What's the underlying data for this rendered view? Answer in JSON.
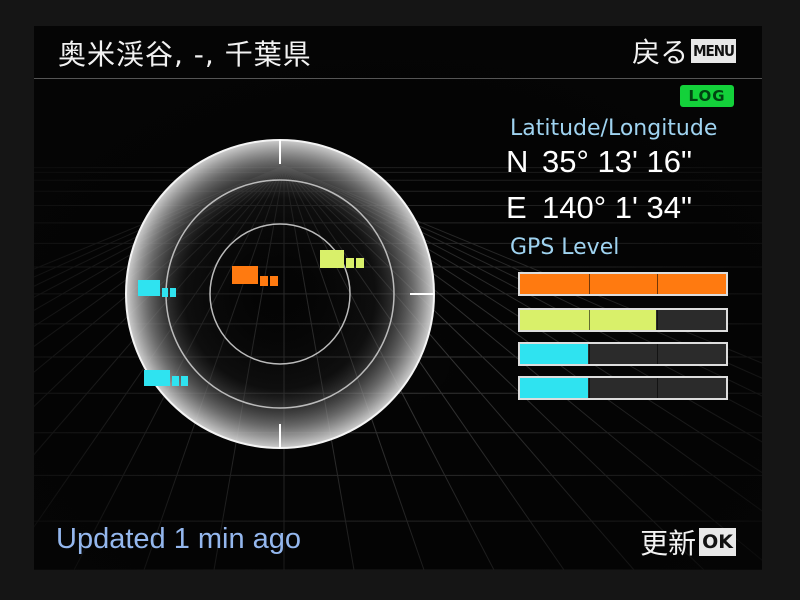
{
  "header": {
    "location": "奥米渓谷, -, 千葉県",
    "back_label": "戻る",
    "back_key": "MENU"
  },
  "log_badge": "LOG",
  "position": {
    "label": "Latitude/Longitude",
    "lat_dir": "N",
    "lat_value": "35° 13' 16\"",
    "lon_dir": "E",
    "lon_value": "140° 1' 34\""
  },
  "gps": {
    "label": "GPS Level",
    "levels": [
      {
        "fraction": 1.0,
        "color": "#ff7a10"
      },
      {
        "fraction": 0.66,
        "color": "#d9f06a"
      },
      {
        "fraction": 0.33,
        "color": "#2fe3f0"
      },
      {
        "fraction": 0.33,
        "color": "#2fe3f0"
      }
    ]
  },
  "footer": {
    "status": "Updated 1 min ago",
    "refresh_label": "更新",
    "refresh_key": "OK"
  },
  "colors": {
    "orange": "#ff7a10",
    "yellow_green": "#d9f06a",
    "cyan": "#2fe3f0",
    "log_green": "#13d13a",
    "label_blue": "#9fd3f0",
    "status_blue": "#94b7ee"
  }
}
